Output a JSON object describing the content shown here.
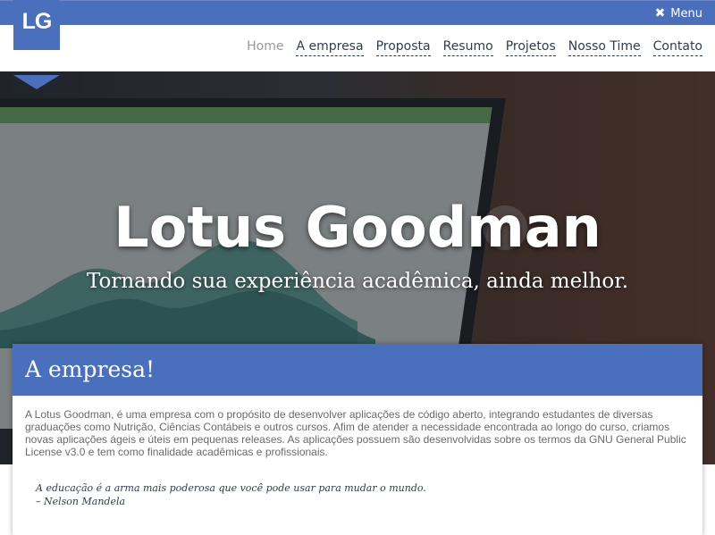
{
  "topbar": {
    "menu_icon": "close-icon",
    "menu_label": "Menu"
  },
  "brand": {
    "logo": "LG"
  },
  "nav": [
    {
      "label": "Home"
    },
    {
      "label": "A empresa"
    },
    {
      "label": "Proposta"
    },
    {
      "label": "Resumo"
    },
    {
      "label": "Projetos"
    },
    {
      "label": "Nosso Time"
    },
    {
      "label": "Contato"
    }
  ],
  "hero": {
    "title": "Lotus Goodman",
    "subtitle": "Tornando sua experiência acadêmica, ainda melhor."
  },
  "about": {
    "heading": "A empresa!",
    "body": "A Lotus Goodman, é uma empresa com o propósito de desenvolver aplicações de código aberto, integrando estudantes de diversas graduações como Nutrição, Ciências Contábeis e outros cursos. Afim de atender a necessidade encontrada ao longo do curso, criamos novas aplicações ágeis e úteis em pequenas releases. As aplicações possuem são desenvolvidas sobre os termos da GNU General Public License v3.0 e tem como finalidade acadêmicas e profissionais.",
    "quote": "A educação é a arma mais poderosa que você pode usar para mudar o mundo.",
    "quote_author": "– Nelson Mandela"
  },
  "colors": {
    "accent": "#4a6fbd",
    "text": "#2c3e50"
  }
}
